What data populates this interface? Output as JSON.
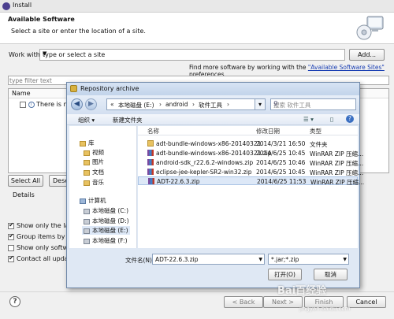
{
  "window": {
    "title": "Install"
  },
  "header": {
    "title": "Available Software",
    "subtitle": "Select a site or enter the location of a site."
  },
  "work_with": {
    "label": "Work with:",
    "value": "type or select a site",
    "add_button": "Add...",
    "find_prefix": "Find more software by working with the ",
    "find_link": "\"Available Software Sites\"",
    "find_suffix": " preferences."
  },
  "filter": {
    "placeholder": "type filter text"
  },
  "tree": {
    "column": "Name",
    "row_text": "There is no s"
  },
  "buttons": {
    "select_all": "Select All",
    "deselect": "Dese"
  },
  "details": {
    "label": "Details"
  },
  "options": [
    {
      "text": "Show only the latest",
      "checked": true
    },
    {
      "text": "Group items by categ",
      "checked": true
    },
    {
      "text": "Show only software a",
      "checked": false
    },
    {
      "text": "Contact all update sit",
      "checked": true
    }
  ],
  "footer": {
    "help": "?",
    "back": "< Back",
    "next": "Next >",
    "finish": "Finish",
    "cancel": "Cancel"
  },
  "dialog": {
    "title": "Repository archive",
    "path": [
      "«",
      "本地磁盘 (E:)",
      "android",
      "软件工具"
    ],
    "search_placeholder": "搜索 软件工具",
    "toolbar": {
      "organize": "组织 ▾",
      "new_folder": "新建文件夹"
    },
    "nav": [
      {
        "label": "库",
        "icon": "library-icon",
        "kind": "folder"
      },
      {
        "label": "视频",
        "icon": "video-icon",
        "kind": "folder"
      },
      {
        "label": "图片",
        "icon": "pictures-icon",
        "kind": "folder"
      },
      {
        "label": "文档",
        "icon": "documents-icon",
        "kind": "folder"
      },
      {
        "label": "音乐",
        "icon": "music-icon",
        "kind": "folder"
      },
      {
        "label": "计算机",
        "icon": "computer-icon",
        "kind": "pc"
      },
      {
        "label": "本地磁盘 (C:)",
        "icon": "drive-icon",
        "kind": "drive"
      },
      {
        "label": "本地磁盘 (D:)",
        "icon": "drive-icon",
        "kind": "drive"
      },
      {
        "label": "本地磁盘 (E:)",
        "icon": "drive-icon",
        "kind": "drive",
        "selected": true
      },
      {
        "label": "本地磁盘 (F:)",
        "icon": "drive-icon",
        "kind": "drive"
      }
    ],
    "columns": {
      "name": "名称",
      "date": "修改日期",
      "type": "类型"
    },
    "files": [
      {
        "name": "adt-bundle-windows-x86-20140321",
        "date": "2014/3/21 16:50",
        "type": "文件夹",
        "kind": "folder"
      },
      {
        "name": "adt-bundle-windows-x86-20140321.zip",
        "date": "2014/6/25 10:45",
        "type": "WinRAR ZIP 压缩...",
        "kind": "zip"
      },
      {
        "name": "android-sdk_r22.6.2-windows.zip",
        "date": "2014/6/25 10:46",
        "type": "WinRAR ZIP 压缩...",
        "kind": "zip"
      },
      {
        "name": "eclipse-jee-kepler-SR2-win32.zip",
        "date": "2014/6/25 10:45",
        "type": "WinRAR ZIP 压缩...",
        "kind": "zip"
      },
      {
        "name": "ADT-22.6.3.zip",
        "date": "2014/6/25 11:53",
        "type": "WinRAR ZIP 压缩...",
        "kind": "zip",
        "selected": true
      }
    ],
    "filename_label": "文件名(N):",
    "filename_value": "ADT-22.6.3.zip",
    "filetype_value": "*.jar;*.zip",
    "open_button": "打开(O)",
    "cancel_button": "取消"
  },
  "watermark": {
    "main": "Bai百经验",
    "sub": "jingyan.baidu.com"
  }
}
